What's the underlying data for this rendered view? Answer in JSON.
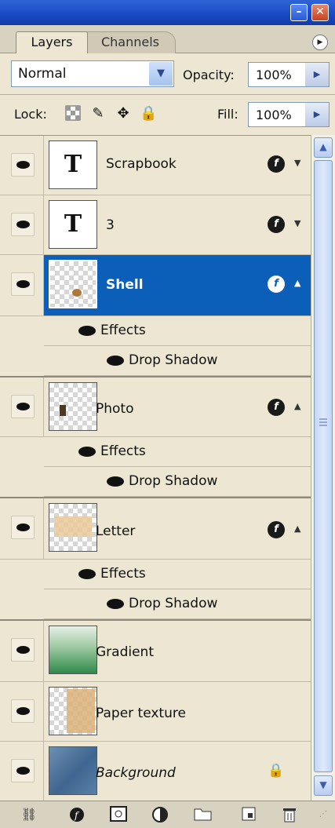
{
  "window": {
    "minimize_icon": "minimize-icon",
    "close_icon": "close-icon"
  },
  "tabs": [
    {
      "label": "Layers",
      "active": true
    },
    {
      "label": "Channels",
      "active": false
    }
  ],
  "blend": {
    "mode": "Normal",
    "opacity_label": "Opacity:",
    "opacity_value": "100%"
  },
  "lock": {
    "label": "Lock:",
    "fill_label": "Fill:",
    "fill_value": "100%"
  },
  "layers": [
    {
      "name": "Scrapbook",
      "type": "text"
    },
    {
      "name": "3",
      "type": "text"
    },
    {
      "name": "Shell",
      "type": "image",
      "selected": true,
      "effects_label": "Effects",
      "effect": "Drop Shadow"
    },
    {
      "name": "Photo",
      "type": "image",
      "effects_label": "Effects",
      "effect": "Drop Shadow"
    },
    {
      "name": "Letter",
      "type": "image",
      "effects_label": "Effects",
      "effect": "Drop Shadow"
    },
    {
      "name": "Gradient",
      "type": "image"
    },
    {
      "name": "Paper texture",
      "type": "image"
    },
    {
      "name": "Background",
      "type": "image",
      "locked": true
    }
  ],
  "colors": {
    "selection": "#0b5fb8",
    "panel_bg": "#ece6d3",
    "titlebar": "#1b4bc4"
  }
}
